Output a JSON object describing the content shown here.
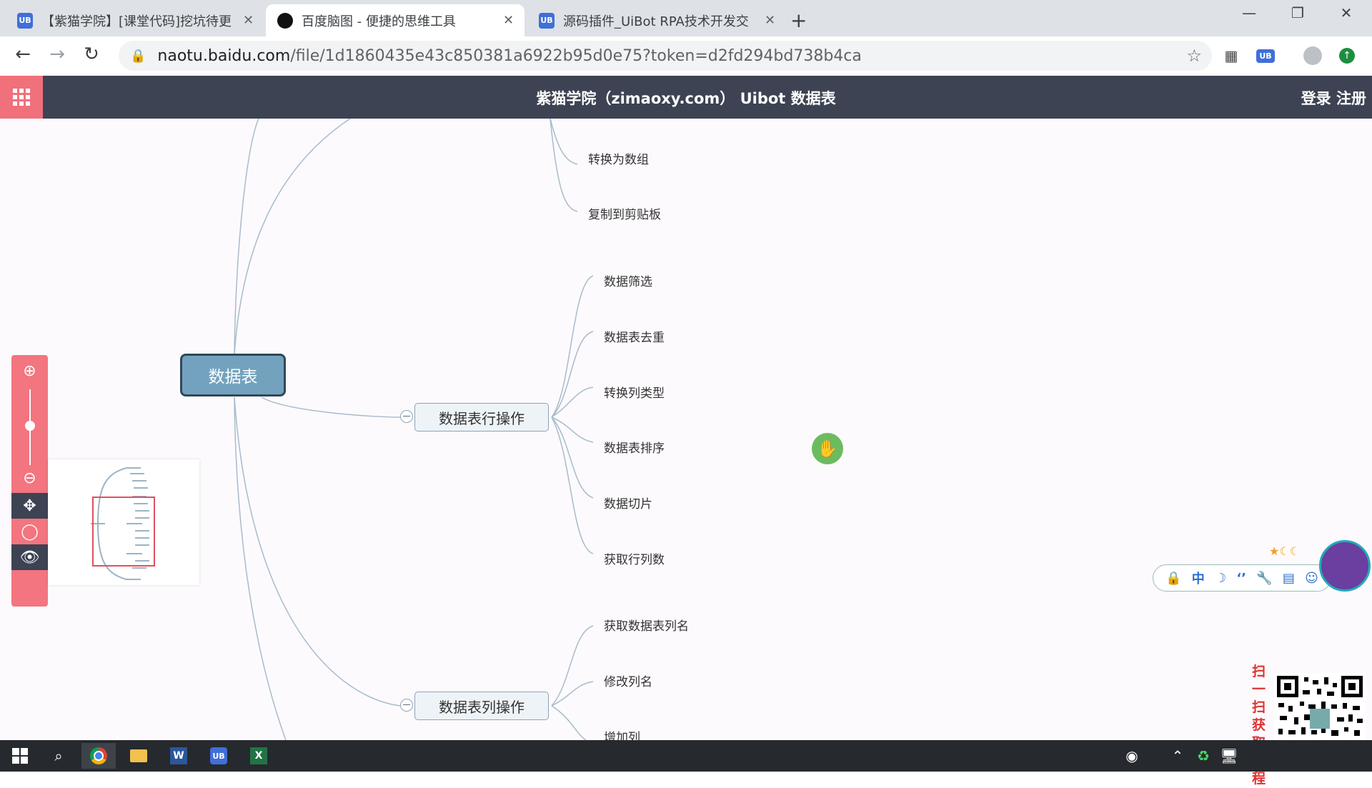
{
  "browser": {
    "tabs": [
      {
        "title": "【紫猫学院】[课堂代码]挖坑待更",
        "icon": "UB"
      },
      {
        "title": "百度脑图 - 便捷的思维工具",
        "icon": "owl"
      },
      {
        "title": "源码插件_UiBot RPA技术开发交",
        "icon": "UB"
      }
    ],
    "url_domain": "naotu.baidu.com",
    "url_path": "/file/1d1860435e43c850381a6922b95d0e75?token=d2fd294bd738b4ca",
    "ext_ub": "UB"
  },
  "app": {
    "title": "紫猫学院（zimaoxy.com） Uibot 数据表",
    "auth": "登录 注册"
  },
  "mindmap": {
    "root": "数据表",
    "branch1_tail": [
      "转换为数组",
      "复制到剪贴板"
    ],
    "row_ops": {
      "label": "数据表行操作",
      "children": [
        "数据筛选",
        "数据表去重",
        "转换列类型",
        "数据表排序",
        "数据切片",
        "获取行列数"
      ]
    },
    "col_ops": {
      "label": "数据表列操作",
      "children": [
        "获取数据表列名",
        "修改列名",
        "增加列"
      ]
    }
  },
  "ime": {
    "items": [
      "🔒",
      "中",
      "☽",
      "‘’",
      "🔧",
      "▤",
      "☺"
    ],
    "stars": "★☾☾"
  },
  "qr_caption": "扫一扫获取教程",
  "taskbar": {
    "apps": [
      "windows-start",
      "search",
      "chrome",
      "file-explorer",
      "word",
      "uibot",
      "excel"
    ],
    "ub_label": "UB",
    "w_label": "W",
    "x_label": "X"
  }
}
